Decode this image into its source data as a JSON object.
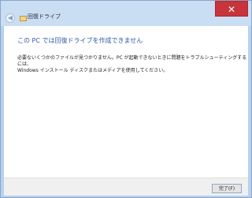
{
  "window": {
    "title": "回復ドライブ",
    "close_label": "✕",
    "back_icon": "back-arrow-icon",
    "title_icon": "drive-icon"
  },
  "content": {
    "heading": "この PC では回復ドライブを作成できません",
    "message": "必要ないくつかのファイルが見つかりません。PC が起動できないときに問題をトラブルシューティングするには、\nWindows インストール ディスクまたはメディアを使用してください。"
  },
  "footer": {
    "finish_label": "完了(F)"
  }
}
